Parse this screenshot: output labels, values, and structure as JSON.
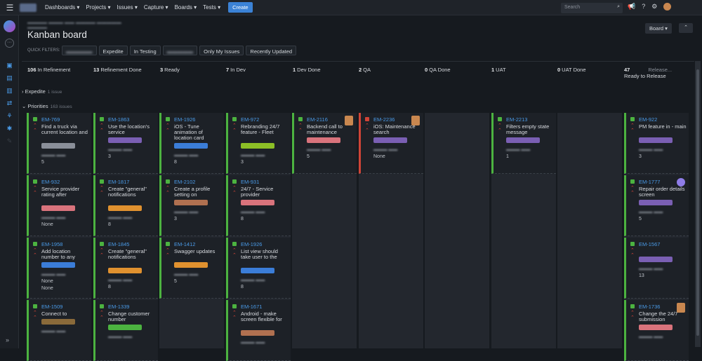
{
  "nav": {
    "items": [
      "Dashboards ▾",
      "Projects ▾",
      "Issues ▾",
      "Capture ▾",
      "Boards ▾",
      "Tests ▾"
    ],
    "create_label": "Create",
    "search_placeholder": "Search"
  },
  "page": {
    "title": "Kanban board",
    "board_button": "Board ▾",
    "collapse_label": "⌃"
  },
  "quick_filters": {
    "label": "QUICK FILTERS:",
    "buttons": [
      "Expedite",
      "In Testing",
      "Only My Issues",
      "Recently Updated"
    ]
  },
  "columns": [
    {
      "count": "106",
      "name": "In Refinement"
    },
    {
      "count": "13",
      "name": "Refinement Done"
    },
    {
      "count": "3",
      "name": "Ready"
    },
    {
      "count": "7",
      "name": "In Dev"
    },
    {
      "count": "1",
      "name": "Dev Done"
    },
    {
      "count": "2",
      "name": "QA"
    },
    {
      "count": "0",
      "name": "QA Done"
    },
    {
      "count": "1",
      "name": "UAT"
    },
    {
      "count": "0",
      "name": "UAT Done"
    },
    {
      "count": "47",
      "name": "Ready to Release",
      "extra": "Release..."
    }
  ],
  "swimlanes": {
    "expedite": {
      "name": "Expedite",
      "count": "1 issue"
    },
    "priorities": {
      "name": "Priorities",
      "count": "163 issues"
    }
  },
  "cards": {
    "c1": [
      {
        "key": "EM-769",
        "summary": "Find a truck via current location and",
        "epic_color": "#8a8f99",
        "est": "5"
      },
      {
        "key": "EM-932",
        "summary": "Service provider rating after",
        "epic_color": "#d9737c",
        "est": "None"
      },
      {
        "key": "EM-1958",
        "summary": "Add location number to any",
        "epic_color": "#3b7dd8",
        "est": "None",
        "est2": "None"
      },
      {
        "key": "EM-1509",
        "summary": "Connect to",
        "epic_color": "#8a6a3a",
        "est": ""
      }
    ],
    "c2": [
      {
        "key": "EM-1863",
        "summary": "Use the location's service",
        "epic_color": "#7a5fb3",
        "est": "3"
      },
      {
        "key": "EM-1817",
        "summary": "Create \"general\" notifications",
        "epic_color": "#e0912f",
        "est": "8"
      },
      {
        "key": "EM-1845",
        "summary": "Create \"general\" notifications",
        "epic_color": "#e0912f",
        "est": "8"
      },
      {
        "key": "EM-1339",
        "summary": "Change customer number",
        "epic_color": "#4cb340",
        "est": ""
      }
    ],
    "c3": [
      {
        "key": "EM-1926",
        "summary": "iOS - Tune animation of location card",
        "epic_color": "#3b7dd8",
        "est": "8"
      },
      {
        "key": "EM-2102",
        "summary": "Create a profile setting on",
        "epic_color": "#b07050",
        "est": "3"
      },
      {
        "key": "EM-1412",
        "summary": "Swagger updates",
        "epic_color": "#e0912f",
        "est": "5"
      }
    ],
    "c4": [
      {
        "key": "EM-972",
        "summary": "Rebranding 24/7 feature - Fleet",
        "epic_color": "#8cbf26",
        "est": "3"
      },
      {
        "key": "EM-931",
        "summary": "24/7 - Service provider",
        "epic_color": "#d9737c",
        "est": "8"
      },
      {
        "key": "EM-1926",
        "summary": "List view should take user to the",
        "epic_color": "#3b7dd8",
        "est": "8"
      },
      {
        "key": "EM-1671",
        "summary": "Android - make screen flexible for",
        "epic_color": "#b07050",
        "est": ""
      }
    ],
    "c5": [
      {
        "key": "EM-2116",
        "summary": "Backend call to maintenance",
        "epic_color": "#d9737c",
        "est": "5"
      }
    ],
    "c6": [
      {
        "key": "EM-2236",
        "summary": "iOS: Maintenance search",
        "epic_color": "#7a5fb3",
        "est": "None"
      }
    ],
    "c8": [
      {
        "key": "EM-2213",
        "summary": "Filters empty state message",
        "epic_color": "#7a5fb3",
        "est": "1"
      }
    ],
    "c10": [
      {
        "key": "EM-922",
        "summary": "PM feature in - main",
        "epic_color": "#7a5fb3",
        "est": "3"
      },
      {
        "key": "EM-1777",
        "summary": "Repair order details screen",
        "epic_color": "#7a5fb3",
        "est": "5"
      },
      {
        "key": "EM-1567",
        "summary": "",
        "epic_color": "#7a5fb3",
        "est": "13"
      },
      {
        "key": "EM-1736",
        "summary": "Change the 24/7 submission",
        "epic_color": "#d9737c",
        "est": ""
      }
    ]
  }
}
